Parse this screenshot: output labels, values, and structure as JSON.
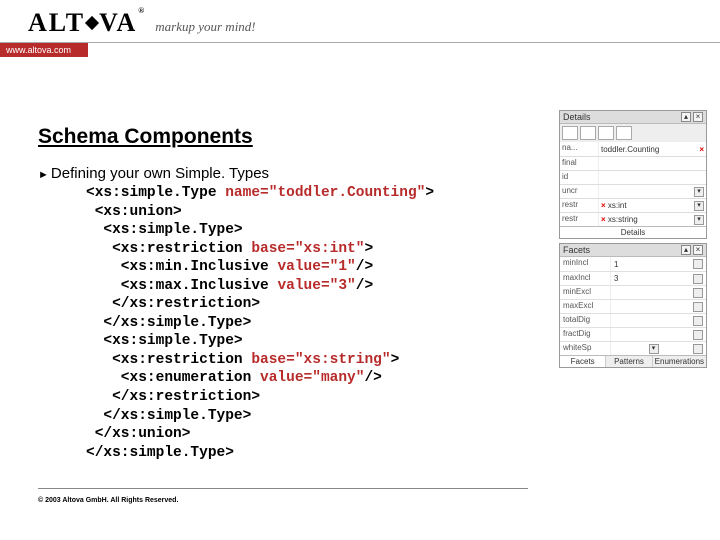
{
  "header": {
    "logo_text_pre": "ALT",
    "logo_text_post": "VA",
    "tagline": "markup your mind!",
    "url": "www.altova.com"
  },
  "section_title": "Schema Components",
  "bullet": "Defining your own Simple. Types",
  "code": {
    "l1_a": "<xs:simple.Type ",
    "l1_b": "name=\"toddler.Counting\"",
    "l1_c": ">",
    "l2": " <xs:union>",
    "l3": "  <xs:simple.Type>",
    "l4_a": "   <xs:restriction ",
    "l4_b": "base=\"xs:int\"",
    "l4_c": ">",
    "l5_a": "    <xs:min.Inclusive ",
    "l5_b": "value=\"1\"",
    "l5_c": "/>",
    "l6_a": "    <xs:max.Inclusive ",
    "l6_b": "value=\"3\"",
    "l6_c": "/>",
    "l7": "   </xs:restriction>",
    "l8": "  </xs:simple.Type>",
    "l9": "  <xs:simple.Type>",
    "l10_a": "   <xs:restriction ",
    "l10_b": "base=\"xs:string\"",
    "l10_c": ">",
    "l11_a": "    <xs:enumeration ",
    "l11_b": "value=\"many\"",
    "l11_c": "/>",
    "l12": "   </xs:restriction>",
    "l13": "  </xs:simple.Type>",
    "l14": " </xs:union>",
    "l15": "</xs:simple.Type>"
  },
  "copyright": "© 2003 Altova GmbH. All Rights Reserved.",
  "panel1": {
    "title": "Details",
    "name_val": "toddler.Counting",
    "rows": [
      {
        "lbl": "na...",
        "val": ""
      },
      {
        "lbl": "final",
        "val": ""
      },
      {
        "lbl": "id",
        "val": ""
      },
      {
        "lbl": "uncr",
        "val": "",
        "drop": true
      },
      {
        "lbl": "restr",
        "val": "xs:int",
        "x": true,
        "drop": true
      },
      {
        "lbl": "restr",
        "val": "xs:string",
        "x": true,
        "drop": true
      }
    ],
    "footer": "Details"
  },
  "panel2": {
    "title": "Facets",
    "rows": [
      {
        "lbl": "minIncl",
        "val": "1"
      },
      {
        "lbl": "maxIncl",
        "val": "3"
      },
      {
        "lbl": "minExcl",
        "val": ""
      },
      {
        "lbl": "maxExcl",
        "val": ""
      },
      {
        "lbl": "totalDig",
        "val": ""
      },
      {
        "lbl": "fractDig",
        "val": ""
      },
      {
        "lbl": "whiteSp",
        "val": "",
        "drop": true
      }
    ],
    "tabs": [
      "Facets",
      "Patterns",
      "Enumerations"
    ]
  }
}
